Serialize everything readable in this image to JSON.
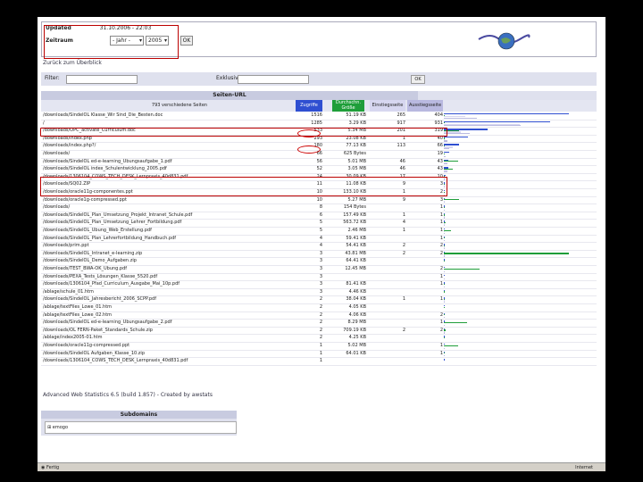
{
  "header": {
    "updated_label": "Updated",
    "updated_value": "31.10.2006 - 22:03",
    "period_label": "Zeitraum",
    "month_value": "- Jahr -",
    "year_value": "2005",
    "ok_label": "OK"
  },
  "summary_label": "Zurück zum Überblick",
  "filter": {
    "filter_label": "Filter:",
    "exclude_label": "Exklusiv-Filter:",
    "ok_label": "OK"
  },
  "table": {
    "title": "Seiten-URL",
    "headers": {
      "url": "793 verschiedene Seiten",
      "views": "Zugriffe",
      "avg_size": "Durchschn. Größe",
      "entry": "Einstiegsseite",
      "exit": "Ausstiegsseite"
    },
    "colors": {
      "views": "#2f4fd1",
      "size": "#1f9e3a",
      "entry": "#d7d7f0",
      "exit": "#b9b9e0"
    },
    "rows": [
      {
        "url": "/downloads/SindelOL Klasse_Wir Sind_Die_Besten.doc",
        "views": "1516",
        "size": "51.19 KB",
        "entry": "265",
        "exit": "404"
      },
      {
        "url": "/",
        "views": "1285",
        "size": "3.29 KB",
        "entry": "917",
        "exit": "931"
      },
      {
        "url": "/downloads/OPC_activate_Curriculum.doc",
        "views": "533",
        "size": "5.34 MB",
        "entry": "201",
        "exit": "319"
      },
      {
        "url": "/downloads/index.php",
        "views": "293",
        "size": "23.08 KB",
        "entry": "1",
        "exit": "40"
      },
      {
        "url": "/downloads/index.php?/",
        "views": "180",
        "size": "77.13 KB",
        "entry": "113",
        "exit": "66"
      },
      {
        "url": "/downloads/",
        "views": "66",
        "size": "625 Bytes",
        "entry": "",
        "exit": "19"
      },
      {
        "url": "/downloads/SindelOL ed-e-learning_Übungsaufgabe_1.pdf",
        "views": "56",
        "size": "5.01 MB",
        "entry": "46",
        "exit": "43"
      },
      {
        "url": "/downloads/SindelOL index_Schulentwicklung_2005.pdf",
        "views": "52",
        "size": "3.05 MB",
        "entry": "46",
        "exit": "43"
      },
      {
        "url": "/downloads/1306104_COWS_TECH_DESK_Lernpraxis_40d831.pdf",
        "views": "24",
        "size": "30.09 KB",
        "entry": "17",
        "exit": "10"
      },
      {
        "url": "/downloads/SQ02.ZIP",
        "views": "11",
        "size": "11.08 KB",
        "entry": "9",
        "exit": "3"
      },
      {
        "url": "/downloads/oracle11g-componentes.ppt",
        "views": "10",
        "size": "133.10 KB",
        "entry": "1",
        "exit": "2"
      },
      {
        "url": "/downloads/oracle1g-compressed.ppt",
        "views": "10",
        "size": "5.27 MB",
        "entry": "9",
        "exit": "3"
      },
      {
        "url": "/downloads/",
        "views": "8",
        "size": "154 Bytes",
        "entry": "",
        "exit": "1"
      },
      {
        "url": "/downloads/SindelOL_Plan_Umsetzung_Projekt_Intranet_Schule.pdf",
        "views": "6",
        "size": "157.49 KB",
        "entry": "1",
        "exit": "1"
      },
      {
        "url": "/downloads/SindelOL_Plan_Umsetzung_Lehrer_Fortbildung.pdf",
        "views": "5",
        "size": "563.72 KB",
        "entry": "4",
        "exit": "1"
      },
      {
        "url": "/downloads/SindelOL_Übung_Web_Erstellung.pdf",
        "views": "5",
        "size": "2.46 MB",
        "entry": "1",
        "exit": "1"
      },
      {
        "url": "/downloads/SindelOL_Plan_Lehrerfortbildung_Handbuch.pdf",
        "views": "4",
        "size": "59.41 KB",
        "entry": "",
        "exit": "1"
      },
      {
        "url": "/downloads/prim.ppt",
        "views": "4",
        "size": "54.41 KB",
        "entry": "2",
        "exit": "2"
      },
      {
        "url": "/downloads/SindelOL_Intranet_e-learning.zip",
        "views": "3",
        "size": "43.81 MB",
        "entry": "2",
        "exit": "2"
      },
      {
        "url": "/downloads/SindelOL_Demo_Aufgaben.zip",
        "views": "3",
        "size": "64.41 KB",
        "entry": "",
        "exit": ""
      },
      {
        "url": "/downloads/TEST_BWA-OK_Übung.pdf",
        "views": "3",
        "size": "12.45 MB",
        "entry": "",
        "exit": "2"
      },
      {
        "url": "/downloads/PEXA_Tests_Lösungen_Klasse_5520.pdf",
        "views": "3",
        "size": "",
        "entry": "",
        "exit": "1"
      },
      {
        "url": "/downloads/1306104_Pfad_Curriculum_Ausgabe_Mai_10p.pdf",
        "views": "3",
        "size": "81.41 KB",
        "entry": "",
        "exit": "1"
      },
      {
        "url": "/ablage/schule_01.htm",
        "views": "3",
        "size": "4.46 KB",
        "entry": "",
        "exit": ""
      },
      {
        "url": "/downloads/SindelOL_Jahresbericht_2006_SCPP.pdf",
        "views": "2",
        "size": "38.04 KB",
        "entry": "1",
        "exit": "1"
      },
      {
        "url": "/ablage/textFiles_Lowe_01.htm",
        "views": "2",
        "size": "4.05 KB",
        "entry": "",
        "exit": ""
      },
      {
        "url": "/ablage/textFiles_Lowe_02.htm",
        "views": "2",
        "size": "4.06 KB",
        "entry": "",
        "exit": "2"
      },
      {
        "url": "/downloads/SindelOL ed-e-learning_Übungsaufgabe_2.pdf",
        "views": "2",
        "size": "8.29 MB",
        "entry": "",
        "exit": "1"
      },
      {
        "url": "/downloads/OL FERN-Paket_Standards_Schule.zip",
        "views": "2",
        "size": "709.19 KB",
        "entry": "2",
        "exit": "2"
      },
      {
        "url": "/ablage/index2005-01.htm",
        "views": "2",
        "size": "4.25 KB",
        "entry": "",
        "exit": ""
      },
      {
        "url": "/downloads/oracle11g-compressed.ppt",
        "views": "1",
        "size": "5.02 MB",
        "entry": "",
        "exit": "1"
      },
      {
        "url": "/downloads/SindelOL Aufgaben_Klasse_10.zip",
        "views": "1",
        "size": "64.01 KB",
        "entry": "",
        "exit": "1"
      },
      {
        "url": "/downloads/1306104_COWS_TECH_DESK_Lernpraxis_40d831.pdf",
        "views": "1",
        "size": "",
        "entry": "",
        "exit": ""
      }
    ]
  },
  "footer": "Advanced Web Statistics 6.5 (build 1.857) - Created by awstats",
  "subdomains": {
    "title": "Subdomains",
    "value": "emogo"
  },
  "statusbar": {
    "left": "Fertig",
    "right": "Internet"
  }
}
